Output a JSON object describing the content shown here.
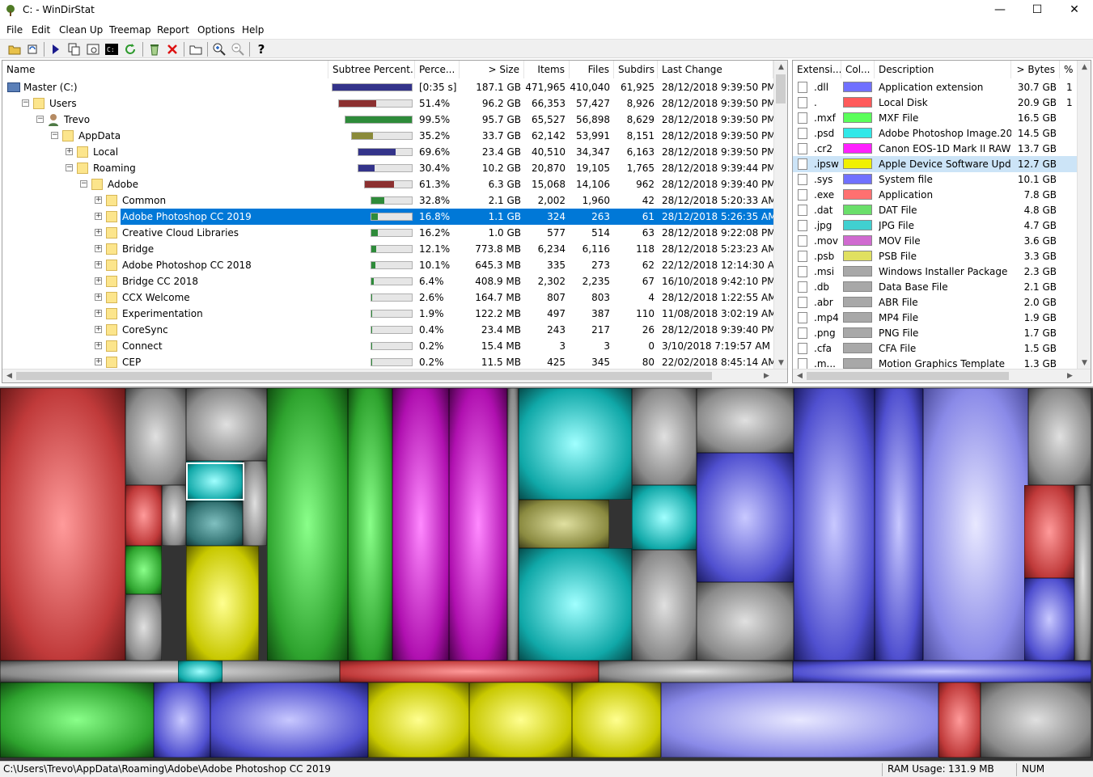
{
  "window": {
    "title": "C: - WinDirStat",
    "minimize": "—",
    "maximize": "☐",
    "close": "✕"
  },
  "menu": [
    "File",
    "Edit",
    "Clean Up",
    "Treemap",
    "Report",
    "Options",
    "Help"
  ],
  "toolbar": [
    "open-icon",
    "refresh-icon",
    "play-icon",
    "copy-path-icon",
    "explorer-icon",
    "cmd-icon",
    "refresh-selected-icon",
    "recycle-icon",
    "delete-icon",
    "new-window-icon",
    "zoom-in-icon",
    "zoom-out-icon",
    "help-icon"
  ],
  "tree": {
    "columns": [
      "Name",
      "Subtree Percent...",
      "Perce...",
      "> Size",
      "Items",
      "Files",
      "Subdirs",
      "Last Change"
    ],
    "rows": [
      {
        "name": "Master (C:)",
        "level": 0,
        "exp": "",
        "pct_text": "[0:35 s]",
        "pct": 100,
        "bar": "#33338a",
        "size": "187.1 GB",
        "items": "471,965",
        "files": "410,040",
        "subdirs": "61,925",
        "changed": "28/12/2018  9:39:50 PM",
        "icon": "drive"
      },
      {
        "name": "Users",
        "level": 1,
        "exp": "⊟",
        "pct_text": "51.4%",
        "pct": 51.4,
        "bar": "#8c3030",
        "size": "96.2 GB",
        "items": "66,353",
        "files": "57,427",
        "subdirs": "8,926",
        "changed": "28/12/2018  9:39:50 PM",
        "icon": "folder"
      },
      {
        "name": "Trevo",
        "level": 2,
        "exp": "⊟",
        "pct_text": "99.5%",
        "pct": 99.5,
        "bar": "#2e8b3a",
        "size": "95.7 GB",
        "items": "65,527",
        "files": "56,898",
        "subdirs": "8,629",
        "changed": "28/12/2018  9:39:50 PM",
        "icon": "user"
      },
      {
        "name": "AppData",
        "level": 3,
        "exp": "⊟",
        "pct_text": "35.2%",
        "pct": 35.2,
        "bar": "#8a8a3a",
        "size": "33.7 GB",
        "items": "62,142",
        "files": "53,991",
        "subdirs": "8,151",
        "changed": "28/12/2018  9:39:50 PM",
        "icon": "folder"
      },
      {
        "name": "Local",
        "level": 4,
        "exp": "⊞",
        "pct_text": "69.6%",
        "pct": 69.6,
        "bar": "#33338a",
        "size": "23.4 GB",
        "items": "40,510",
        "files": "34,347",
        "subdirs": "6,163",
        "changed": "28/12/2018  9:39:50 PM",
        "icon": "folder"
      },
      {
        "name": "Roaming",
        "level": 4,
        "exp": "⊟",
        "pct_text": "30.4%",
        "pct": 30.4,
        "bar": "#33338a",
        "size": "10.2 GB",
        "items": "20,870",
        "files": "19,105",
        "subdirs": "1,765",
        "changed": "28/12/2018  9:39:44 PM",
        "icon": "folder"
      },
      {
        "name": "Adobe",
        "level": 5,
        "exp": "⊟",
        "pct_text": "61.3%",
        "pct": 61.3,
        "bar": "#8c3030",
        "size": "6.3 GB",
        "items": "15,068",
        "files": "14,106",
        "subdirs": "962",
        "changed": "28/12/2018  9:39:40 PM",
        "icon": "folder"
      },
      {
        "name": "Common",
        "level": 6,
        "exp": "⊞",
        "pct_text": "32.8%",
        "pct": 32.8,
        "bar": "#2e8b3a",
        "size": "2.1 GB",
        "items": "2,002",
        "files": "1,960",
        "subdirs": "42",
        "changed": "28/12/2018  5:20:33 AM",
        "icon": "folder"
      },
      {
        "name": "Adobe Photoshop CC 2019",
        "level": 6,
        "exp": "⊞",
        "pct_text": "16.8%",
        "pct": 16.8,
        "bar": "#2e8b3a",
        "size": "1.1 GB",
        "items": "324",
        "files": "263",
        "subdirs": "61",
        "changed": "28/12/2018  5:26:35 AM",
        "icon": "folder",
        "selected": true
      },
      {
        "name": "Creative Cloud Libraries",
        "level": 6,
        "exp": "⊞",
        "pct_text": "16.2%",
        "pct": 16.2,
        "bar": "#2e8b3a",
        "size": "1.0 GB",
        "items": "577",
        "files": "514",
        "subdirs": "63",
        "changed": "28/12/2018  9:22:08 PM",
        "icon": "folder"
      },
      {
        "name": "Bridge",
        "level": 6,
        "exp": "⊞",
        "pct_text": "12.1%",
        "pct": 12.1,
        "bar": "#2e8b3a",
        "size": "773.8 MB",
        "items": "6,234",
        "files": "6,116",
        "subdirs": "118",
        "changed": "28/12/2018  5:23:23 AM",
        "icon": "folder"
      },
      {
        "name": "Adobe Photoshop CC 2018",
        "level": 6,
        "exp": "⊞",
        "pct_text": "10.1%",
        "pct": 10.1,
        "bar": "#2e8b3a",
        "size": "645.3 MB",
        "items": "335",
        "files": "273",
        "subdirs": "62",
        "changed": "22/12/2018  12:14:30 AM",
        "icon": "folder"
      },
      {
        "name": "Bridge CC 2018",
        "level": 6,
        "exp": "⊞",
        "pct_text": "6.4%",
        "pct": 6.4,
        "bar": "#2e8b3a",
        "size": "408.9 MB",
        "items": "2,302",
        "files": "2,235",
        "subdirs": "67",
        "changed": "16/10/2018  9:42:10 PM",
        "icon": "folder"
      },
      {
        "name": "CCX Welcome",
        "level": 6,
        "exp": "⊞",
        "pct_text": "2.6%",
        "pct": 2.6,
        "bar": "#2e8b3a",
        "size": "164.7 MB",
        "items": "807",
        "files": "803",
        "subdirs": "4",
        "changed": "28/12/2018  1:22:55 AM",
        "icon": "folder"
      },
      {
        "name": "Experimentation",
        "level": 6,
        "exp": "⊞",
        "pct_text": "1.9%",
        "pct": 1.9,
        "bar": "#2e8b3a",
        "size": "122.2 MB",
        "items": "497",
        "files": "387",
        "subdirs": "110",
        "changed": "11/08/2018  3:02:19 AM",
        "icon": "folder"
      },
      {
        "name": "CoreSync",
        "level": 6,
        "exp": "⊞",
        "pct_text": "0.4%",
        "pct": 0.4,
        "bar": "#2e8b3a",
        "size": "23.4 MB",
        "items": "243",
        "files": "217",
        "subdirs": "26",
        "changed": "28/12/2018  9:39:40 PM",
        "icon": "folder"
      },
      {
        "name": "Connect",
        "level": 6,
        "exp": "⊞",
        "pct_text": "0.2%",
        "pct": 0.2,
        "bar": "#2e8b3a",
        "size": "15.4 MB",
        "items": "3",
        "files": "3",
        "subdirs": "0",
        "changed": "3/10/2018  7:19:57 AM",
        "icon": "folder"
      },
      {
        "name": "CEP",
        "level": 6,
        "exp": "⊞",
        "pct_text": "0.2%",
        "pct": 0.2,
        "bar": "#2e8b3a",
        "size": "11.5 MB",
        "items": "425",
        "files": "345",
        "subdirs": "80",
        "changed": "22/02/2018  8:45:14 AM",
        "icon": "folder"
      }
    ]
  },
  "extensions": {
    "columns": [
      "Extensi...",
      "Col...",
      "Description",
      "> Bytes",
      "%"
    ],
    "rows": [
      {
        "ext": ".dll",
        "color": "#7070ff",
        "desc": "Application extension",
        "bytes": "30.7 GB",
        "pct": "1"
      },
      {
        "ext": ".",
        "color": "#ff5a5a",
        "desc": "Local Disk",
        "bytes": "20.9 GB",
        "pct": "1"
      },
      {
        "ext": ".mxf",
        "color": "#5aff5a",
        "desc": "MXF File",
        "bytes": "16.5 GB",
        "pct": ""
      },
      {
        "ext": ".psd",
        "color": "#30e8e8",
        "desc": "Adobe Photoshop Image.20",
        "bytes": "14.5 GB",
        "pct": ""
      },
      {
        "ext": ".cr2",
        "color": "#ff20ff",
        "desc": "Canon EOS-1D Mark II RAW",
        "bytes": "13.7 GB",
        "pct": ""
      },
      {
        "ext": ".ipsw",
        "color": "#f0f000",
        "desc": "Apple Device Software Upda...",
        "bytes": "12.7 GB",
        "pct": "",
        "selected": true
      },
      {
        "ext": ".sys",
        "color": "#7070ff",
        "desc": "System file",
        "bytes": "10.1 GB",
        "pct": ""
      },
      {
        "ext": ".exe",
        "color": "#ff7070",
        "desc": "Application",
        "bytes": "7.8 GB",
        "pct": ""
      },
      {
        "ext": ".dat",
        "color": "#6adf6a",
        "desc": "DAT File",
        "bytes": "4.8 GB",
        "pct": ""
      },
      {
        "ext": ".jpg",
        "color": "#40d0d0",
        "desc": "JPG File",
        "bytes": "4.7 GB",
        "pct": ""
      },
      {
        "ext": ".mov",
        "color": "#d06ad0",
        "desc": "MOV File",
        "bytes": "3.6 GB",
        "pct": ""
      },
      {
        "ext": ".psb",
        "color": "#e0e060",
        "desc": "PSB File",
        "bytes": "3.3 GB",
        "pct": ""
      },
      {
        "ext": ".msi",
        "color": "#a8a8a8",
        "desc": "Windows Installer Package",
        "bytes": "2.3 GB",
        "pct": ""
      },
      {
        "ext": ".db",
        "color": "#a8a8a8",
        "desc": "Data Base File",
        "bytes": "2.1 GB",
        "pct": ""
      },
      {
        "ext": ".abr",
        "color": "#a8a8a8",
        "desc": "ABR File",
        "bytes": "2.0 GB",
        "pct": ""
      },
      {
        "ext": ".mp4",
        "color": "#a8a8a8",
        "desc": "MP4 File",
        "bytes": "1.9 GB",
        "pct": ""
      },
      {
        "ext": ".png",
        "color": "#a8a8a8",
        "desc": "PNG File",
        "bytes": "1.7 GB",
        "pct": ""
      },
      {
        "ext": ".cfa",
        "color": "#a8a8a8",
        "desc": "CFA File",
        "bytes": "1.5 GB",
        "pct": ""
      },
      {
        "ext": ".m...",
        "color": "#a8a8a8",
        "desc": "Motion Graphics Template",
        "bytes": "1.3 GB",
        "pct": ""
      }
    ]
  },
  "status": {
    "path": "C:\\Users\\Trevo\\AppData\\Roaming\\Adobe\\Adobe Photoshop CC 2019",
    "ram_label": "RAM Usage:",
    "ram_value": "131.9 MB",
    "num": "NUM"
  }
}
